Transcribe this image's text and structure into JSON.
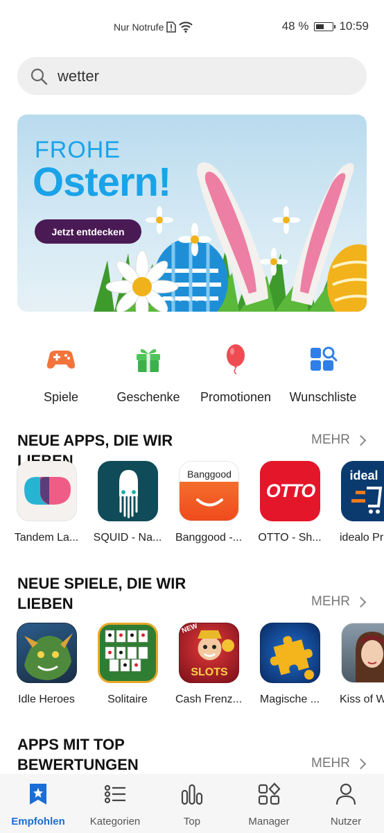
{
  "status_bar": {
    "carrier": "Nur Notrufe",
    "battery": "48 %",
    "battery_level": 0.48,
    "time": "10:59"
  },
  "search": {
    "value": "wetter"
  },
  "banner": {
    "line1": "FROHE",
    "line2": "Ostern!",
    "cta": "Jetzt entdecken",
    "dots": 6,
    "active_dot": 0
  },
  "quick_nav": [
    {
      "label": "Spiele",
      "icon": "gamepad-icon"
    },
    {
      "label": "Geschenke",
      "icon": "gift-icon"
    },
    {
      "label": "Promotionen",
      "icon": "balloon-icon"
    },
    {
      "label": "Wunschliste",
      "icon": "wishlist-icon"
    }
  ],
  "sections": [
    {
      "title": "NEUE APPS, DIE WIR LIEBEN",
      "more": "MEHR",
      "apps": [
        {
          "name": "Tandem La...",
          "icon_text": ""
        },
        {
          "name": "SQUID - Na...",
          "icon_text": ""
        },
        {
          "name": "Banggood -...",
          "icon_text": "Banggood"
        },
        {
          "name": "OTTO - Sh...",
          "icon_text": "OTTO"
        },
        {
          "name": "idealo Pr",
          "icon_text": "ideal"
        }
      ]
    },
    {
      "title": "NEUE SPIELE, DIE WIR LIEBEN",
      "more": "MEHR",
      "apps": [
        {
          "name": "Idle Heroes",
          "icon_text": ""
        },
        {
          "name": "Solitaire",
          "icon_text": ""
        },
        {
          "name": "Cash Frenz...",
          "icon_text": "SLOTS",
          "badge": "NEW"
        },
        {
          "name": "Magische ...",
          "icon_text": ""
        },
        {
          "name": "Kiss of W",
          "icon_text": ""
        }
      ]
    },
    {
      "title": "APPS MIT TOP BEWERTUNGEN",
      "more": "MEHR"
    }
  ],
  "bottom_nav": [
    {
      "label": "Empfohlen",
      "icon": "star-bookmark-icon",
      "active": true
    },
    {
      "label": "Kategorien",
      "icon": "list-icon",
      "active": false
    },
    {
      "label": "Top",
      "icon": "bar-chart-icon",
      "active": false
    },
    {
      "label": "Manager",
      "icon": "apps-grid-icon",
      "active": false
    },
    {
      "label": "Nutzer",
      "icon": "user-icon",
      "active": false
    }
  ],
  "colors": {
    "accent": "#1b6ed6",
    "banner_text": "#1aa3e8",
    "cta_bg": "#4a1a55"
  }
}
